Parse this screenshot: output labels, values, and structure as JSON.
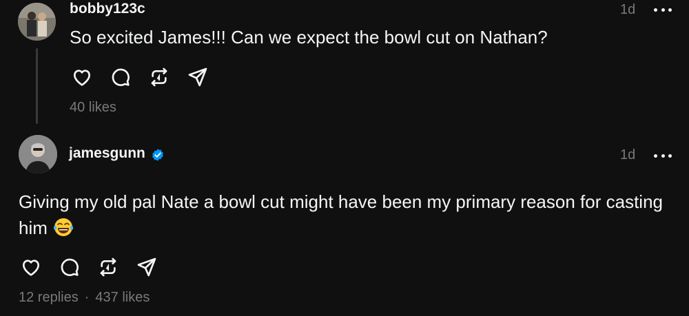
{
  "posts": [
    {
      "username": "bobby123c",
      "time": "1d",
      "text": "So excited James!!! Can we expect the bowl cut on Nathan?",
      "likes": "40 likes",
      "verified": false
    },
    {
      "username": "jamesgunn",
      "time": "1d",
      "text": "Giving my old pal Nate a bowl cut might have been my primary reason for casting him",
      "emoji": "tears-of-joy-emoji",
      "replies": "12 replies",
      "separator": "·",
      "likes": "437 likes",
      "verified": true
    }
  ],
  "icons": [
    "heart-icon",
    "comment-icon",
    "repost-icon",
    "share-icon",
    "more-icon",
    "verified-badge-icon"
  ],
  "colors": {
    "background": "#101010",
    "text": "#f3f5f7",
    "muted": "#7a7a7a",
    "verified": "#0095f6"
  }
}
